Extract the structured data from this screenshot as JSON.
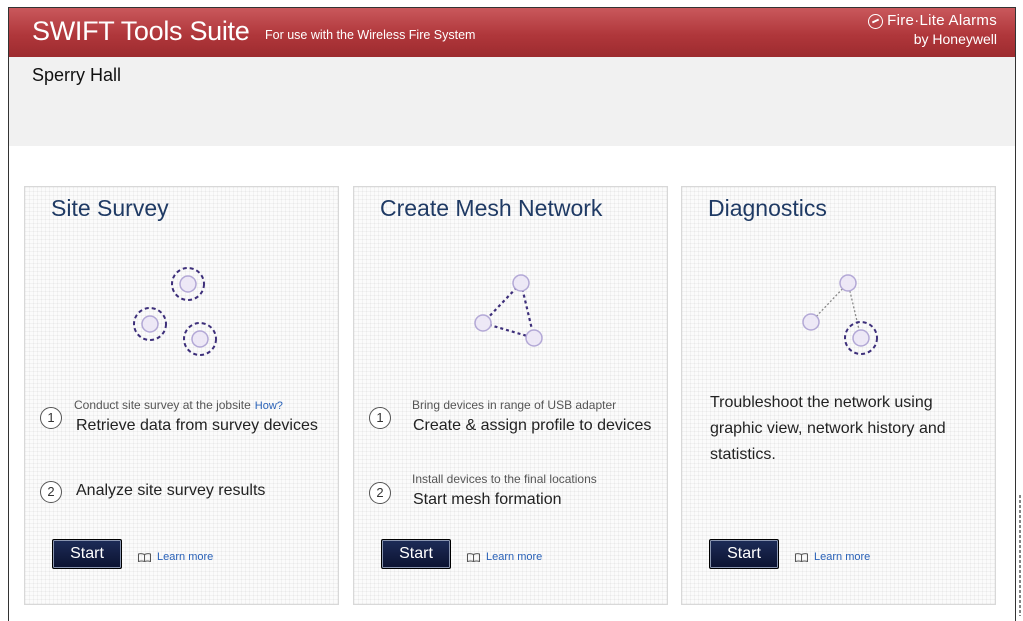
{
  "header": {
    "title": "SWIFT Tools Suite",
    "subtitle": "For use with the Wireless Fire System",
    "brand_line1": "Fire·Lite Alarms",
    "brand_line2": "by Honeywell",
    "brand_icon": "firelite-logo-icon"
  },
  "site": {
    "name": "Sperry Hall"
  },
  "cards": [
    {
      "title": "Site Survey",
      "graphic_icon": "survey-devices-icon",
      "steps": [
        {
          "number": "1",
          "small": "Conduct site survey at the jobsite",
          "link": "How?",
          "main": "Retrieve data from survey devices"
        },
        {
          "number": "2",
          "small": "",
          "main": "Analyze site survey results"
        }
      ],
      "start_label": "Start",
      "learn_more": "Learn more"
    },
    {
      "title": "Create Mesh Network",
      "graphic_icon": "mesh-network-icon",
      "steps": [
        {
          "number": "1",
          "small": "Bring devices in range of USB adapter",
          "main": "Create & assign profile to devices"
        },
        {
          "number": "2",
          "small": "Install devices to the final locations",
          "main": "Start mesh formation"
        }
      ],
      "start_label": "Start",
      "learn_more": "Learn more"
    },
    {
      "title": "Diagnostics",
      "graphic_icon": "diagnostics-network-icon",
      "description": "Troubleshoot the network using graphic view, network history and statistics.",
      "start_label": "Start",
      "learn_more": "Learn more"
    }
  ],
  "colors": {
    "header_red": "#b0373b",
    "title_blue": "#1f3a64",
    "button_navy": "#0f1838",
    "link_blue": "#2a62b8",
    "device_purple": "#3d2f7a"
  }
}
